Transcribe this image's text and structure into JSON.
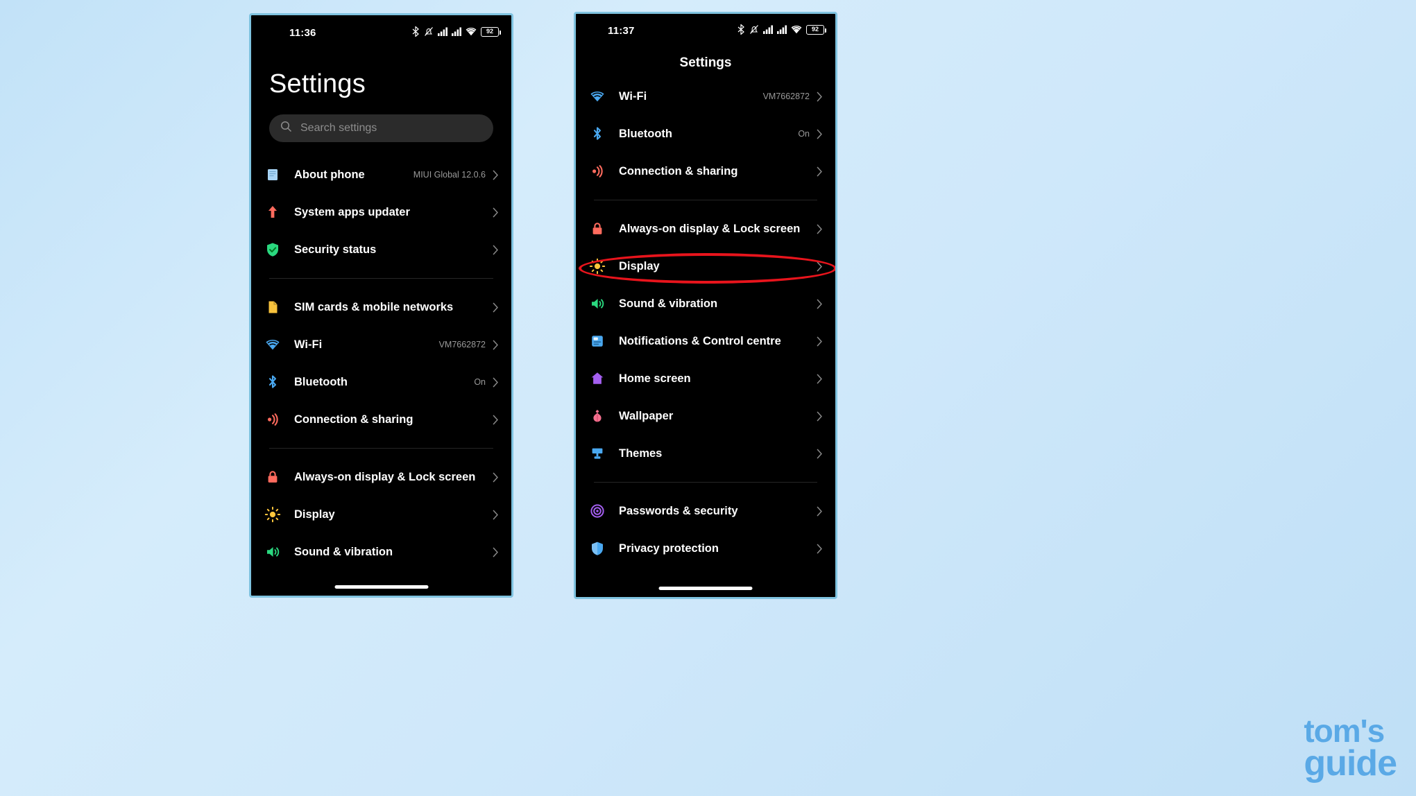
{
  "background_color": "#cfe8fa",
  "accent_red": "#e8141c",
  "watermark": {
    "line1": "tom's",
    "line2": "guide",
    "color": "#5aa9e6"
  },
  "phone_left": {
    "status_bar": {
      "time": "11:36",
      "battery_percent": "92",
      "icons": [
        "bluetooth-icon",
        "silent-bell-icon",
        "signal-bars-icon",
        "signal-bars-icon",
        "wifi-icon",
        "battery-icon"
      ]
    },
    "title": "Settings",
    "search": {
      "placeholder": "Search settings",
      "icon": "search-icon"
    },
    "groups": [
      {
        "items": [
          {
            "icon": "about-phone-icon",
            "icon_color": "#a8d4f5",
            "label": "About phone",
            "value": "MIUI Global 12.0.6"
          },
          {
            "icon": "system-apps-updater-icon",
            "icon_color": "#ff6b5e",
            "label": "System apps updater",
            "value": ""
          },
          {
            "icon": "security-status-icon",
            "icon_color": "#2ad87f",
            "label": "Security status",
            "value": ""
          }
        ]
      },
      {
        "items": [
          {
            "icon": "sim-card-icon",
            "icon_color": "#f7c23c",
            "label": "SIM cards & mobile networks",
            "value": ""
          },
          {
            "icon": "wifi-icon",
            "icon_color": "#4aa8f0",
            "label": "Wi-Fi",
            "value": "VM7662872"
          },
          {
            "icon": "bluetooth-icon",
            "icon_color": "#4aa8f0",
            "label": "Bluetooth",
            "value": "On"
          },
          {
            "icon": "connection-sharing-icon",
            "icon_color": "#ff6b5e",
            "label": "Connection & sharing",
            "value": ""
          }
        ]
      },
      {
        "items": [
          {
            "icon": "lock-icon",
            "icon_color": "#ff6b5e",
            "label": "Always-on display & Lock screen",
            "value": ""
          },
          {
            "icon": "display-icon",
            "icon_color": "#ffc63c",
            "label": "Display",
            "value": ""
          },
          {
            "icon": "sound-vibration-icon",
            "icon_color": "#2ad87f",
            "label": "Sound & vibration",
            "value": ""
          }
        ]
      }
    ]
  },
  "phone_right": {
    "status_bar": {
      "time": "11:37",
      "battery_percent": "92",
      "icons": [
        "bluetooth-icon",
        "silent-bell-icon",
        "signal-bars-icon",
        "signal-bars-icon",
        "wifi-icon",
        "battery-icon"
      ]
    },
    "title": "Settings",
    "highlight": {
      "target_label": "Display",
      "shape": "oval",
      "color": "#e8141c"
    },
    "groups": [
      {
        "items": [
          {
            "icon": "wifi-icon",
            "icon_color": "#4aa8f0",
            "label": "Wi-Fi",
            "value": "VM7662872"
          },
          {
            "icon": "bluetooth-icon",
            "icon_color": "#4aa8f0",
            "label": "Bluetooth",
            "value": "On"
          },
          {
            "icon": "connection-sharing-icon",
            "icon_color": "#ff6b5e",
            "label": "Connection & sharing",
            "value": ""
          }
        ]
      },
      {
        "items": [
          {
            "icon": "lock-icon",
            "icon_color": "#ff6b5e",
            "label": "Always-on display & Lock screen",
            "value": ""
          },
          {
            "icon": "display-icon",
            "icon_color": "#ffc63c",
            "label": "Display",
            "value": ""
          },
          {
            "icon": "sound-vibration-icon",
            "icon_color": "#2ad87f",
            "label": "Sound & vibration",
            "value": ""
          },
          {
            "icon": "notifications-control-centre-icon",
            "icon_color": "#4aa8f0",
            "label": "Notifications & Control centre",
            "value": ""
          },
          {
            "icon": "home-screen-icon",
            "icon_color": "#a45ff0",
            "label": "Home screen",
            "value": ""
          },
          {
            "icon": "wallpaper-icon",
            "icon_color": "#f4708f",
            "label": "Wallpaper",
            "value": ""
          },
          {
            "icon": "themes-icon",
            "icon_color": "#4aa8f0",
            "label": "Themes",
            "value": ""
          }
        ]
      },
      {
        "items": [
          {
            "icon": "passwords-security-icon",
            "icon_color": "#a45ff0",
            "label": "Passwords & security",
            "value": ""
          },
          {
            "icon": "privacy-protection-icon",
            "icon_color": "#4aa8f0",
            "label": "Privacy protection",
            "value": ""
          }
        ]
      }
    ]
  }
}
